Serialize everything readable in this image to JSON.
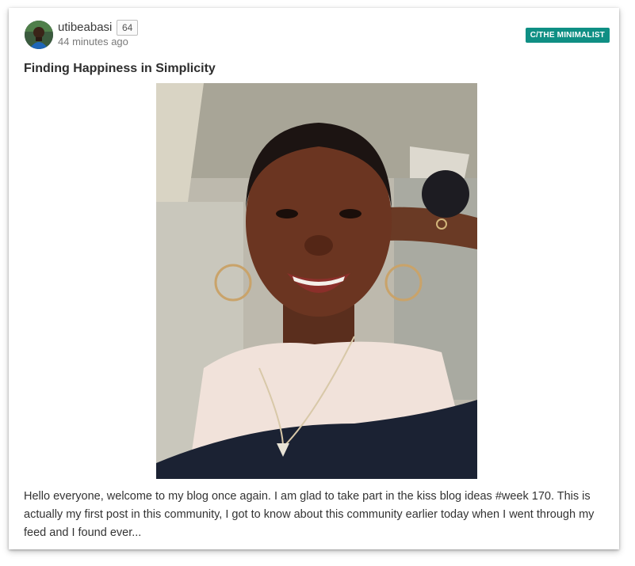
{
  "post": {
    "author": "utibeabasi",
    "reputation": "64",
    "time_ago": "44 minutes ago",
    "community": "C/THE MINIMALIST",
    "title": "Finding Happiness in Simplicity",
    "excerpt": "Hello everyone, welcome to my blog once again. I am glad to take part in the kiss blog ideas #week 170. This is actually my first post in this community, I got to know about this community earlier today when I went through my feed and I found ever...",
    "image_subject": "selfie-photo"
  },
  "colors": {
    "community_tag_bg": "#0f8f84",
    "title_text": "#2d2d2d",
    "body_text": "#333333",
    "meta_text": "#7a7a7a"
  }
}
